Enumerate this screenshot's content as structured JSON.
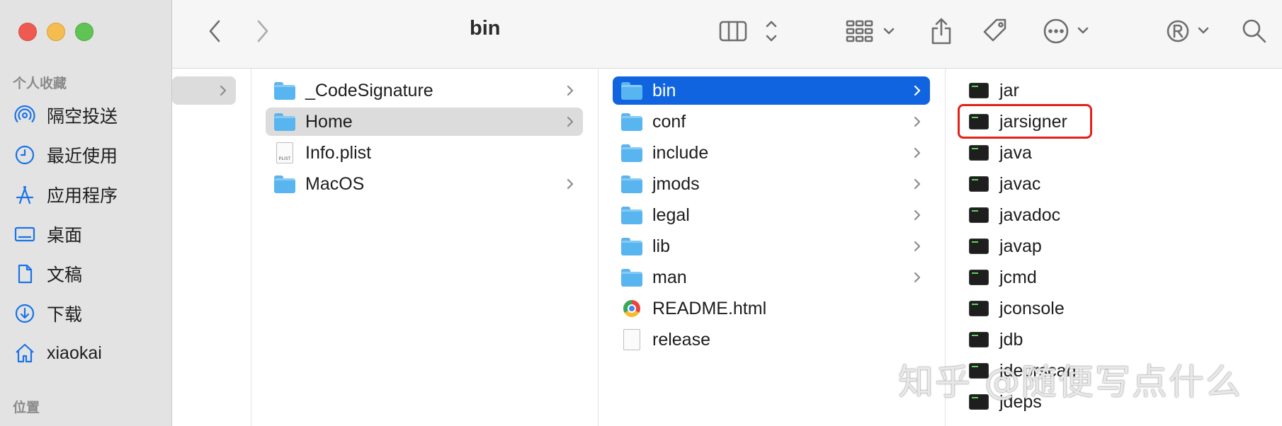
{
  "window": {
    "title": "bin"
  },
  "sidebar": {
    "favorites_heading": "个人收藏",
    "items": [
      {
        "label": "隔空投送",
        "icon": "airdrop-icon"
      },
      {
        "label": "最近使用",
        "icon": "clock-icon"
      },
      {
        "label": "应用程序",
        "icon": "applications-icon"
      },
      {
        "label": "桌面",
        "icon": "desktop-icon"
      },
      {
        "label": "文稿",
        "icon": "document-icon"
      },
      {
        "label": "下载",
        "icon": "download-icon"
      },
      {
        "label": "xiaokai",
        "icon": "home-icon"
      }
    ],
    "locations_heading": "位置"
  },
  "columns": {
    "col2": [
      {
        "name": "_CodeSignature",
        "kind": "folder",
        "expandable": true
      },
      {
        "name": "Home",
        "kind": "folder",
        "expandable": true,
        "selected": true
      },
      {
        "name": "Info.plist",
        "kind": "plist",
        "expandable": false
      },
      {
        "name": "MacOS",
        "kind": "folder",
        "expandable": true
      }
    ],
    "col3": [
      {
        "name": "bin",
        "kind": "folder",
        "expandable": true,
        "selected": true
      },
      {
        "name": "conf",
        "kind": "folder",
        "expandable": true
      },
      {
        "name": "include",
        "kind": "folder",
        "expandable": true
      },
      {
        "name": "jmods",
        "kind": "folder",
        "expandable": true
      },
      {
        "name": "legal",
        "kind": "folder",
        "expandable": true
      },
      {
        "name": "lib",
        "kind": "folder",
        "expandable": true
      },
      {
        "name": "man",
        "kind": "folder",
        "expandable": true
      },
      {
        "name": "README.html",
        "kind": "html",
        "expandable": false
      },
      {
        "name": "release",
        "kind": "file",
        "expandable": false
      }
    ],
    "col4": [
      {
        "name": "jar",
        "kind": "exec"
      },
      {
        "name": "jarsigner",
        "kind": "exec",
        "highlighted": true
      },
      {
        "name": "java",
        "kind": "exec"
      },
      {
        "name": "javac",
        "kind": "exec"
      },
      {
        "name": "javadoc",
        "kind": "exec"
      },
      {
        "name": "javap",
        "kind": "exec"
      },
      {
        "name": "jcmd",
        "kind": "exec"
      },
      {
        "name": "jconsole",
        "kind": "exec"
      },
      {
        "name": "jdb",
        "kind": "exec"
      },
      {
        "name": "jdeprscan",
        "kind": "exec"
      },
      {
        "name": "jdeps",
        "kind": "exec"
      }
    ]
  },
  "plist_badge": "PLIST",
  "watermark": "知乎 @随便写点什么",
  "colors": {
    "selection_blue": "#1064e0",
    "highlight_red": "#e2231a",
    "folder_blue": "#58b5f0"
  }
}
